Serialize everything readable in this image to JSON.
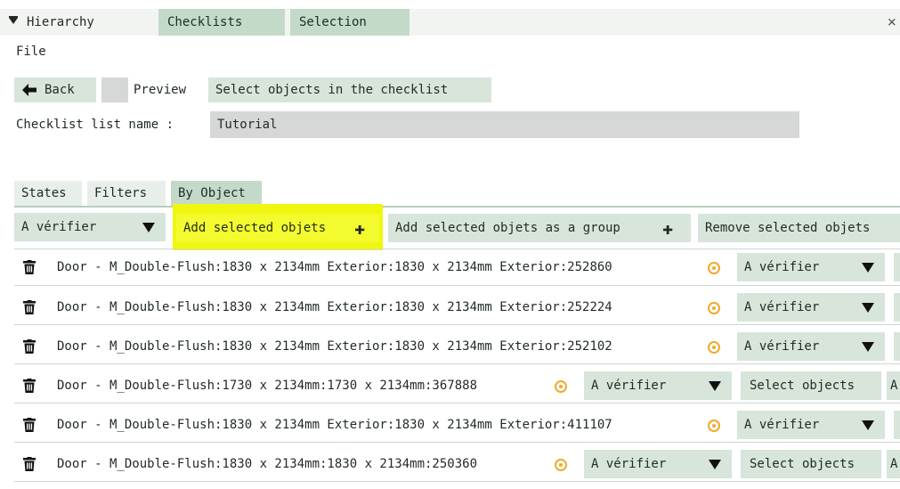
{
  "tabs": [
    {
      "label": "Hierarchy"
    },
    {
      "label": "Checklists"
    },
    {
      "label": "Selection"
    }
  ],
  "close_label": "×",
  "menu": {
    "file": "File"
  },
  "toolbar": {
    "back": "Back",
    "preview": "Preview",
    "select_objects_in_checklist": "Select objects in the checklist"
  },
  "list_name": {
    "label": "Checklist list name :",
    "value": "Tutorial"
  },
  "subtabs": [
    {
      "label": "States"
    },
    {
      "label": "Filters"
    },
    {
      "label": "By Object"
    }
  ],
  "actions": {
    "state_select": "A vérifier",
    "add_selected": "Add selected objets",
    "add_group": "Add selected objets as a group",
    "remove_selected": "Remove selected objets"
  },
  "rows": [
    {
      "name": "Door - M_Double-Flush:1830 x 2134mm Exterior:1830 x 2134mm Exterior:252860",
      "state": "A vérifier"
    },
    {
      "name": "Door - M_Double-Flush:1830 x 2134mm Exterior:1830 x 2134mm Exterior:252224",
      "state": "A vérifier"
    },
    {
      "name": "Door - M_Double-Flush:1830 x 2134mm Exterior:1830 x 2134mm Exterior:252102",
      "state": "A vérifier"
    },
    {
      "name": "Door - M_Double-Flush:1730 x 2134mm:1730 x 2134mm:367888",
      "state": "A vérifier",
      "button": "Select objects",
      "extra": "A"
    },
    {
      "name": "Door - M_Double-Flush:1830 x 2134mm Exterior:1830 x 2134mm Exterior:411107",
      "state": "A vérifier"
    },
    {
      "name": "Door - M_Double-Flush:1830 x 2134mm:1830 x 2134mm:250360",
      "state": "A vérifier",
      "button": "Select objects",
      "extra": "A"
    }
  ],
  "icons": {
    "trash": "trash-icon",
    "target": "target-icon",
    "dropdown": "dropdown-arrow-icon",
    "back_arrow": "arrow-left-icon",
    "plus": "plus-icon",
    "collapse": "collapse-caret-icon"
  },
  "colors": {
    "accent_green": "#c4dac8",
    "highlight_yellow": "#f3fa2e",
    "target_orange": "#f2a92a"
  }
}
